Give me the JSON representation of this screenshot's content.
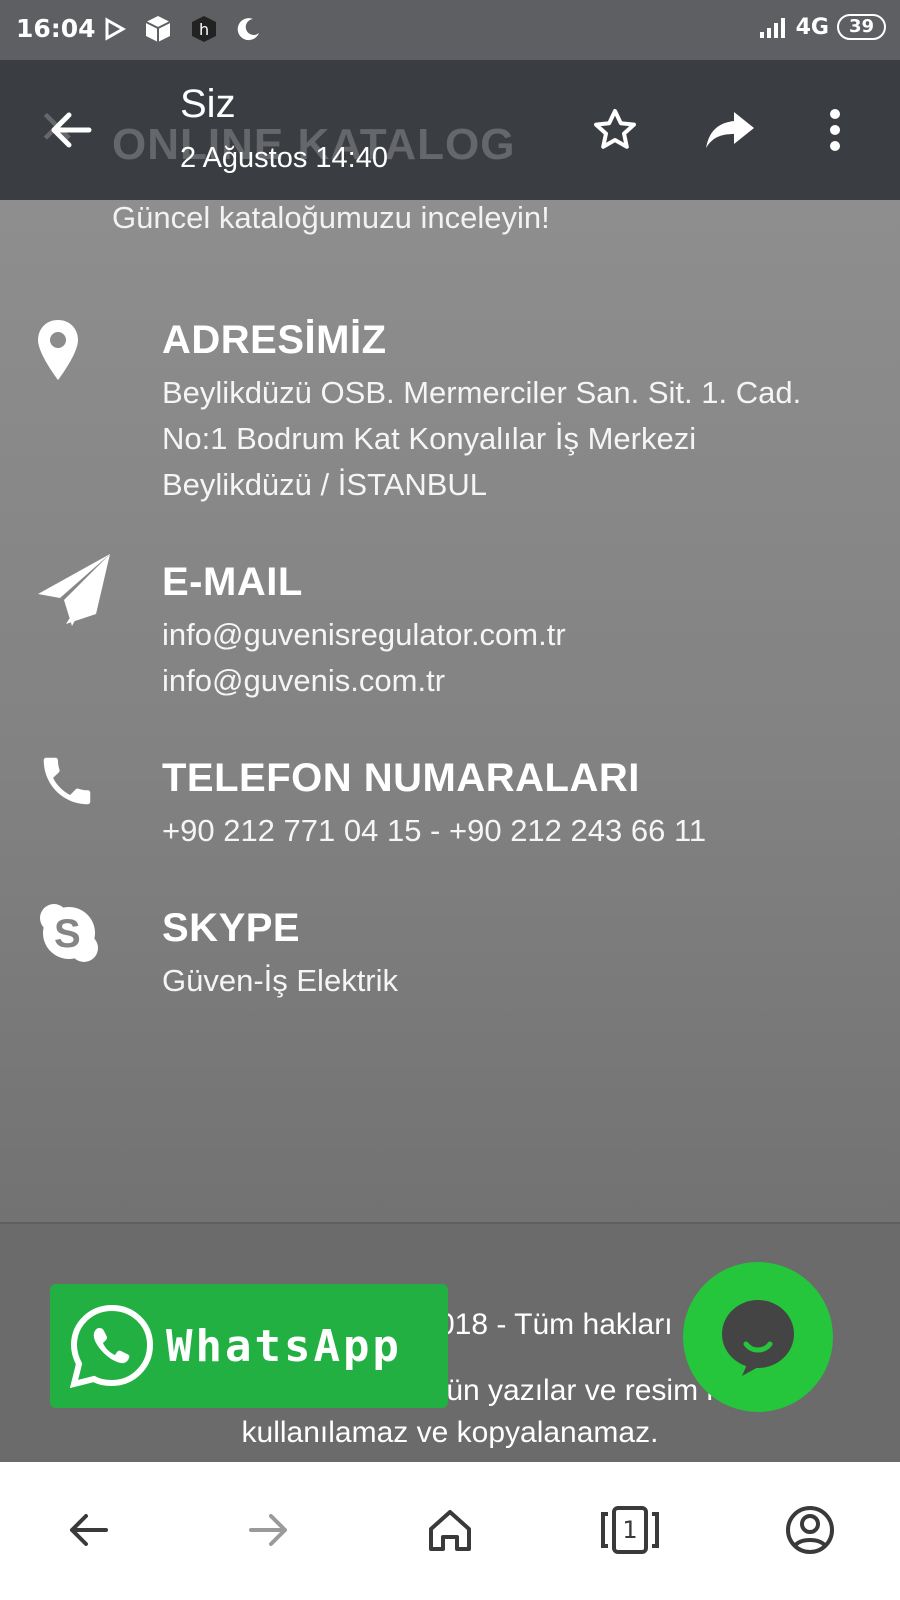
{
  "status_bar": {
    "time": "16:04",
    "network": "4G",
    "battery": "39",
    "icons_left": [
      "play-store-icon",
      "box-icon",
      "app-h-icon",
      "moon-icon"
    ]
  },
  "app_bar": {
    "title": "Siz",
    "subtitle": "2 Ağustos 14:40",
    "ghost_heading": "ONLINE KATALOG",
    "actions": [
      "back-arrow-icon",
      "star-icon",
      "forward-icon",
      "more-vert-icon"
    ]
  },
  "page": {
    "lead": "Güncel kataloğumuzu inceleyin!",
    "address": {
      "title": "ADRESİMİZ",
      "lines": [
        "Beylikdüzü OSB. Mermerciler San. Sit. 1. Cad.",
        "No:1 Bodrum Kat Konyalılar İş Merkezi",
        "Beylikdüzü / İSTANBUL"
      ]
    },
    "email": {
      "title": "E-MAIL",
      "lines": [
        "info@guvenisregulator.com.tr",
        "info@guvenis.com.tr"
      ]
    },
    "phone": {
      "title": "TELEFON NUMARALARI",
      "lines": [
        "+90 212 771 04 15 - +90 212 243 66 11"
      ]
    },
    "skype": {
      "title": "SKYPE",
      "lines": [
        "Güven-İş Elektrik"
      ]
    }
  },
  "footer": {
    "line1": "018 - Tüm hakları",
    "line2": "tün yazılar ve resim          nsiz",
    "line3": "kullanılamaz ve kopyalanamaz."
  },
  "whatsapp_button": {
    "label": "WhatsApp",
    "color": "#22b043"
  },
  "chat_fab": {
    "color": "#25c63b"
  },
  "bottom_nav": [
    "back-icon",
    "forward-icon",
    "home-icon",
    "tabs-icon",
    "account-icon"
  ],
  "tabs_count": "1"
}
